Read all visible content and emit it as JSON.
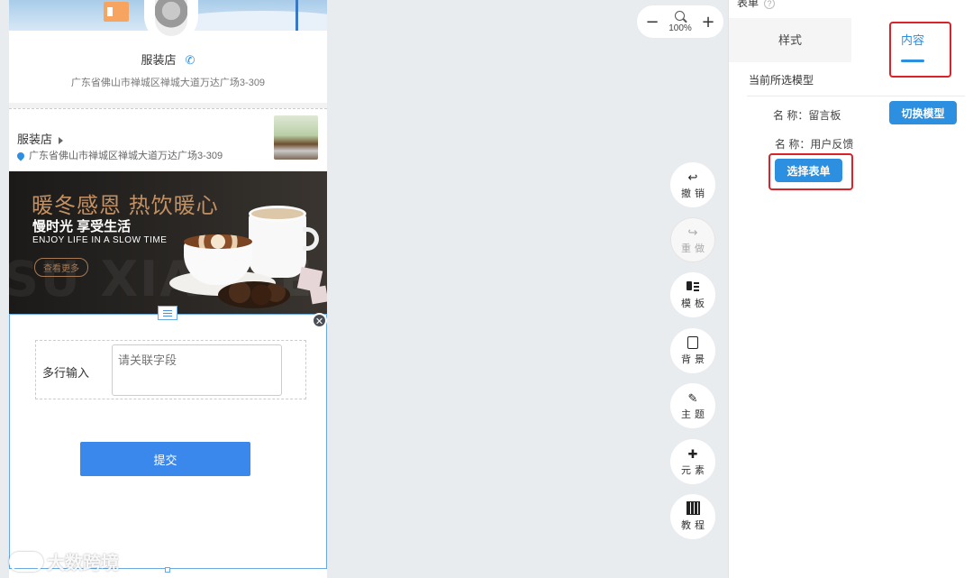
{
  "preview": {
    "store_name": "服装店",
    "store_address": "广东省佛山市禅城区禅城大道万达广场3-309",
    "shop_row": {
      "name": "服装店",
      "address": "广东省佛山市禅城区禅城大道万达广场3-309"
    },
    "banner": {
      "headline": "暖冬感恩 热饮暖心",
      "subheadline": "慢时光 享受生活",
      "english_line": "ENJOY LIFE IN A SLOW TIME",
      "more_button": "查看更多",
      "bg_letters": "SU XIANCE"
    },
    "form": {
      "field_label": "多行输入",
      "field_placeholder": "请关联字段",
      "submit_label": "提交"
    },
    "watermark": "大数跨境"
  },
  "zoom": {
    "minus": "−",
    "plus": "+",
    "level": "100%"
  },
  "tools": [
    {
      "icon": "undo-icon",
      "glyph": "↩",
      "label": "撤销",
      "disabled": false
    },
    {
      "icon": "redo-icon",
      "glyph": "↪",
      "label": "重做",
      "disabled": true
    },
    {
      "icon": "template-icon",
      "glyph": "",
      "label": "模板",
      "disabled": false
    },
    {
      "icon": "background-icon",
      "glyph": "",
      "label": "背景",
      "disabled": false
    },
    {
      "icon": "theme-icon",
      "glyph": "✎",
      "label": "主题",
      "disabled": false
    },
    {
      "icon": "puzzle-icon",
      "glyph": "✚",
      "label": "元素",
      "disabled": false
    },
    {
      "icon": "qrcode-icon",
      "glyph": "",
      "label": "教程",
      "disabled": false
    }
  ],
  "panel": {
    "title": "表单",
    "help": "?",
    "tabs": [
      {
        "label": "样式",
        "active": false
      },
      {
        "label": "内容",
        "active": true
      }
    ],
    "section_title": "当前所选模型",
    "model_name": "名 称：留言板",
    "switch_button": "切换模型",
    "form_name": "名 称：用户反馈",
    "select_button": "选择表单"
  },
  "colors": {
    "accent": "#2d8fe0",
    "submit": "#3b88ec",
    "highlight": "#d9232b",
    "canvas_bg": "#e9ecef"
  }
}
